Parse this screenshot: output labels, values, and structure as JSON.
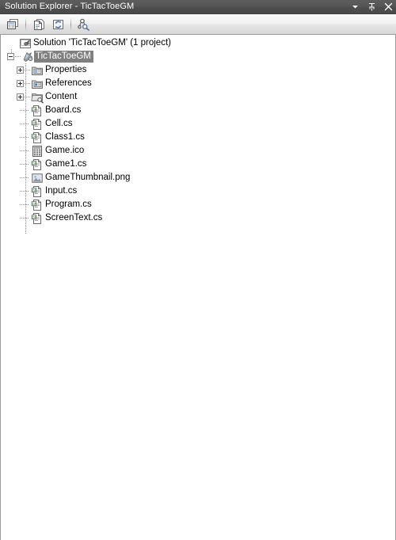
{
  "window": {
    "title": "Solution Explorer - TicTacToeGM",
    "controls": [
      {
        "name": "dropdown-menu-button",
        "glyph": "chevron-down-icon",
        "tooltip": "Window Position"
      },
      {
        "name": "auto-hide-button",
        "glyph": "pin-icon",
        "tooltip": "Auto Hide"
      },
      {
        "name": "close-button",
        "glyph": "close-icon",
        "tooltip": "Close"
      }
    ]
  },
  "toolbar": {
    "buttons": [
      {
        "name": "properties-button",
        "icon": "properties-page-icon",
        "label": "Properties"
      },
      {
        "name": "show-all-files-button",
        "icon": "show-all-files-icon",
        "label": "Show All Files"
      },
      {
        "name": "refresh-button",
        "icon": "refresh-icon",
        "label": "Refresh"
      },
      {
        "name": "view-class-diagram-button",
        "icon": "class-diagram-icon",
        "label": "View Class Diagram"
      }
    ]
  },
  "tree": {
    "nodes": [
      {
        "id": "solution",
        "label": "Solution 'TicTacToeGM' (1 project)",
        "icon": "solution-icon",
        "depth": 0,
        "state": "none",
        "selected": false
      },
      {
        "id": "project",
        "label": "TicTacToeGM",
        "icon": "csharp-project-icon",
        "depth": 1,
        "state": "expanded",
        "selected": true
      },
      {
        "id": "properties",
        "label": "Properties",
        "icon": "properties-folder-icon",
        "depth": 2,
        "state": "collapsed",
        "selected": false
      },
      {
        "id": "references",
        "label": "References",
        "icon": "references-folder-icon",
        "depth": 2,
        "state": "collapsed",
        "selected": false
      },
      {
        "id": "content",
        "label": "Content",
        "icon": "content-folder-icon",
        "depth": 2,
        "state": "collapsed",
        "selected": false
      },
      {
        "id": "board-cs",
        "label": "Board.cs",
        "icon": "csharp-file-icon",
        "depth": 2,
        "state": "leaf",
        "selected": false
      },
      {
        "id": "cell-cs",
        "label": "Cell.cs",
        "icon": "csharp-file-icon",
        "depth": 2,
        "state": "leaf",
        "selected": false
      },
      {
        "id": "class1-cs",
        "label": "Class1.cs",
        "icon": "csharp-file-icon",
        "depth": 2,
        "state": "leaf",
        "selected": false
      },
      {
        "id": "game-ico",
        "label": "Game.ico",
        "icon": "icon-file-icon",
        "depth": 2,
        "state": "leaf",
        "selected": false
      },
      {
        "id": "game1-cs",
        "label": "Game1.cs",
        "icon": "csharp-file-icon",
        "depth": 2,
        "state": "leaf",
        "selected": false
      },
      {
        "id": "gamethumbnail-png",
        "label": "GameThumbnail.png",
        "icon": "image-file-icon",
        "depth": 2,
        "state": "leaf",
        "selected": false
      },
      {
        "id": "input-cs",
        "label": "Input.cs",
        "icon": "csharp-file-icon",
        "depth": 2,
        "state": "leaf",
        "selected": false
      },
      {
        "id": "program-cs",
        "label": "Program.cs",
        "icon": "csharp-file-icon",
        "depth": 2,
        "state": "leaf",
        "selected": false
      },
      {
        "id": "screentext-cs",
        "label": "ScreenText.cs",
        "icon": "csharp-file-icon",
        "depth": 2,
        "state": "leaf",
        "selected": false
      }
    ]
  },
  "colors": {
    "titlebar_bg": "#4f4f4f",
    "titlebar_text": "#ffffff",
    "toolbar_bg": "#eeeeee",
    "pane_bg": "#ffffff",
    "border": "#9a9a9a",
    "selection_bg": "#808080",
    "selection_text": "#ffffff",
    "tree_line": "#8f8f8f",
    "csharp_green": "#4a8f3c"
  }
}
